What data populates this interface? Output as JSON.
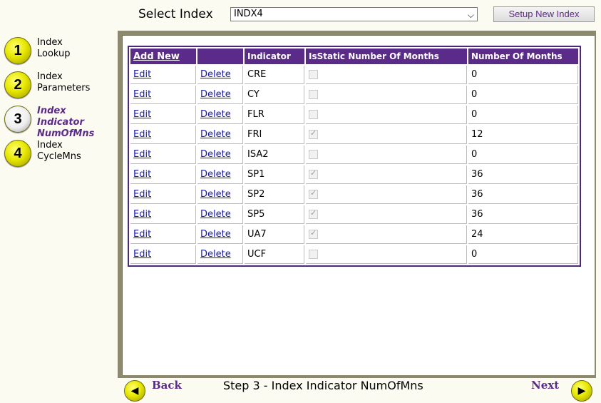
{
  "header": {
    "select_label": "Select Index",
    "selected_index": "INDX4",
    "setup_button": "Setup New Index"
  },
  "steps": [
    {
      "number": "1",
      "label_line1": "Index",
      "label_line2": "Lookup",
      "label_line3": ""
    },
    {
      "number": "2",
      "label_line1": "Index",
      "label_line2": "Parameters",
      "label_line3": ""
    },
    {
      "number": "3",
      "label_line1": "Index",
      "label_line2": "Indicator",
      "label_line3": "NumOfMns"
    },
    {
      "number": "4",
      "label_line1": "Index",
      "label_line2": "CycleMns",
      "label_line3": ""
    }
  ],
  "table": {
    "headers": {
      "add_new": "Add New",
      "delete_col": "",
      "indicator": "Indicator",
      "is_static": "IsStatic Number Of Months",
      "num_months": "Number Of Months"
    },
    "edit_label": "Edit",
    "delete_label": "Delete",
    "rows": [
      {
        "indicator": "CRE",
        "is_static": false,
        "months": "0"
      },
      {
        "indicator": "CY",
        "is_static": false,
        "months": "0"
      },
      {
        "indicator": "FLR",
        "is_static": false,
        "months": "0"
      },
      {
        "indicator": "FRI",
        "is_static": true,
        "months": "12"
      },
      {
        "indicator": "ISA2",
        "is_static": false,
        "months": "0"
      },
      {
        "indicator": "SP1",
        "is_static": true,
        "months": "36"
      },
      {
        "indicator": "SP2",
        "is_static": true,
        "months": "36"
      },
      {
        "indicator": "SP5",
        "is_static": true,
        "months": "36"
      },
      {
        "indicator": "UA7",
        "is_static": true,
        "months": "24"
      },
      {
        "indicator": "UCF",
        "is_static": false,
        "months": "0"
      }
    ]
  },
  "footer": {
    "back_label": "Back",
    "next_label": "Next",
    "step_caption": "Step 3 - Index Indicator NumOfMns"
  },
  "colors": {
    "accent": "#5b2b8a",
    "panel_border": "#8c8a6a",
    "step_circle": "#e8e800"
  }
}
